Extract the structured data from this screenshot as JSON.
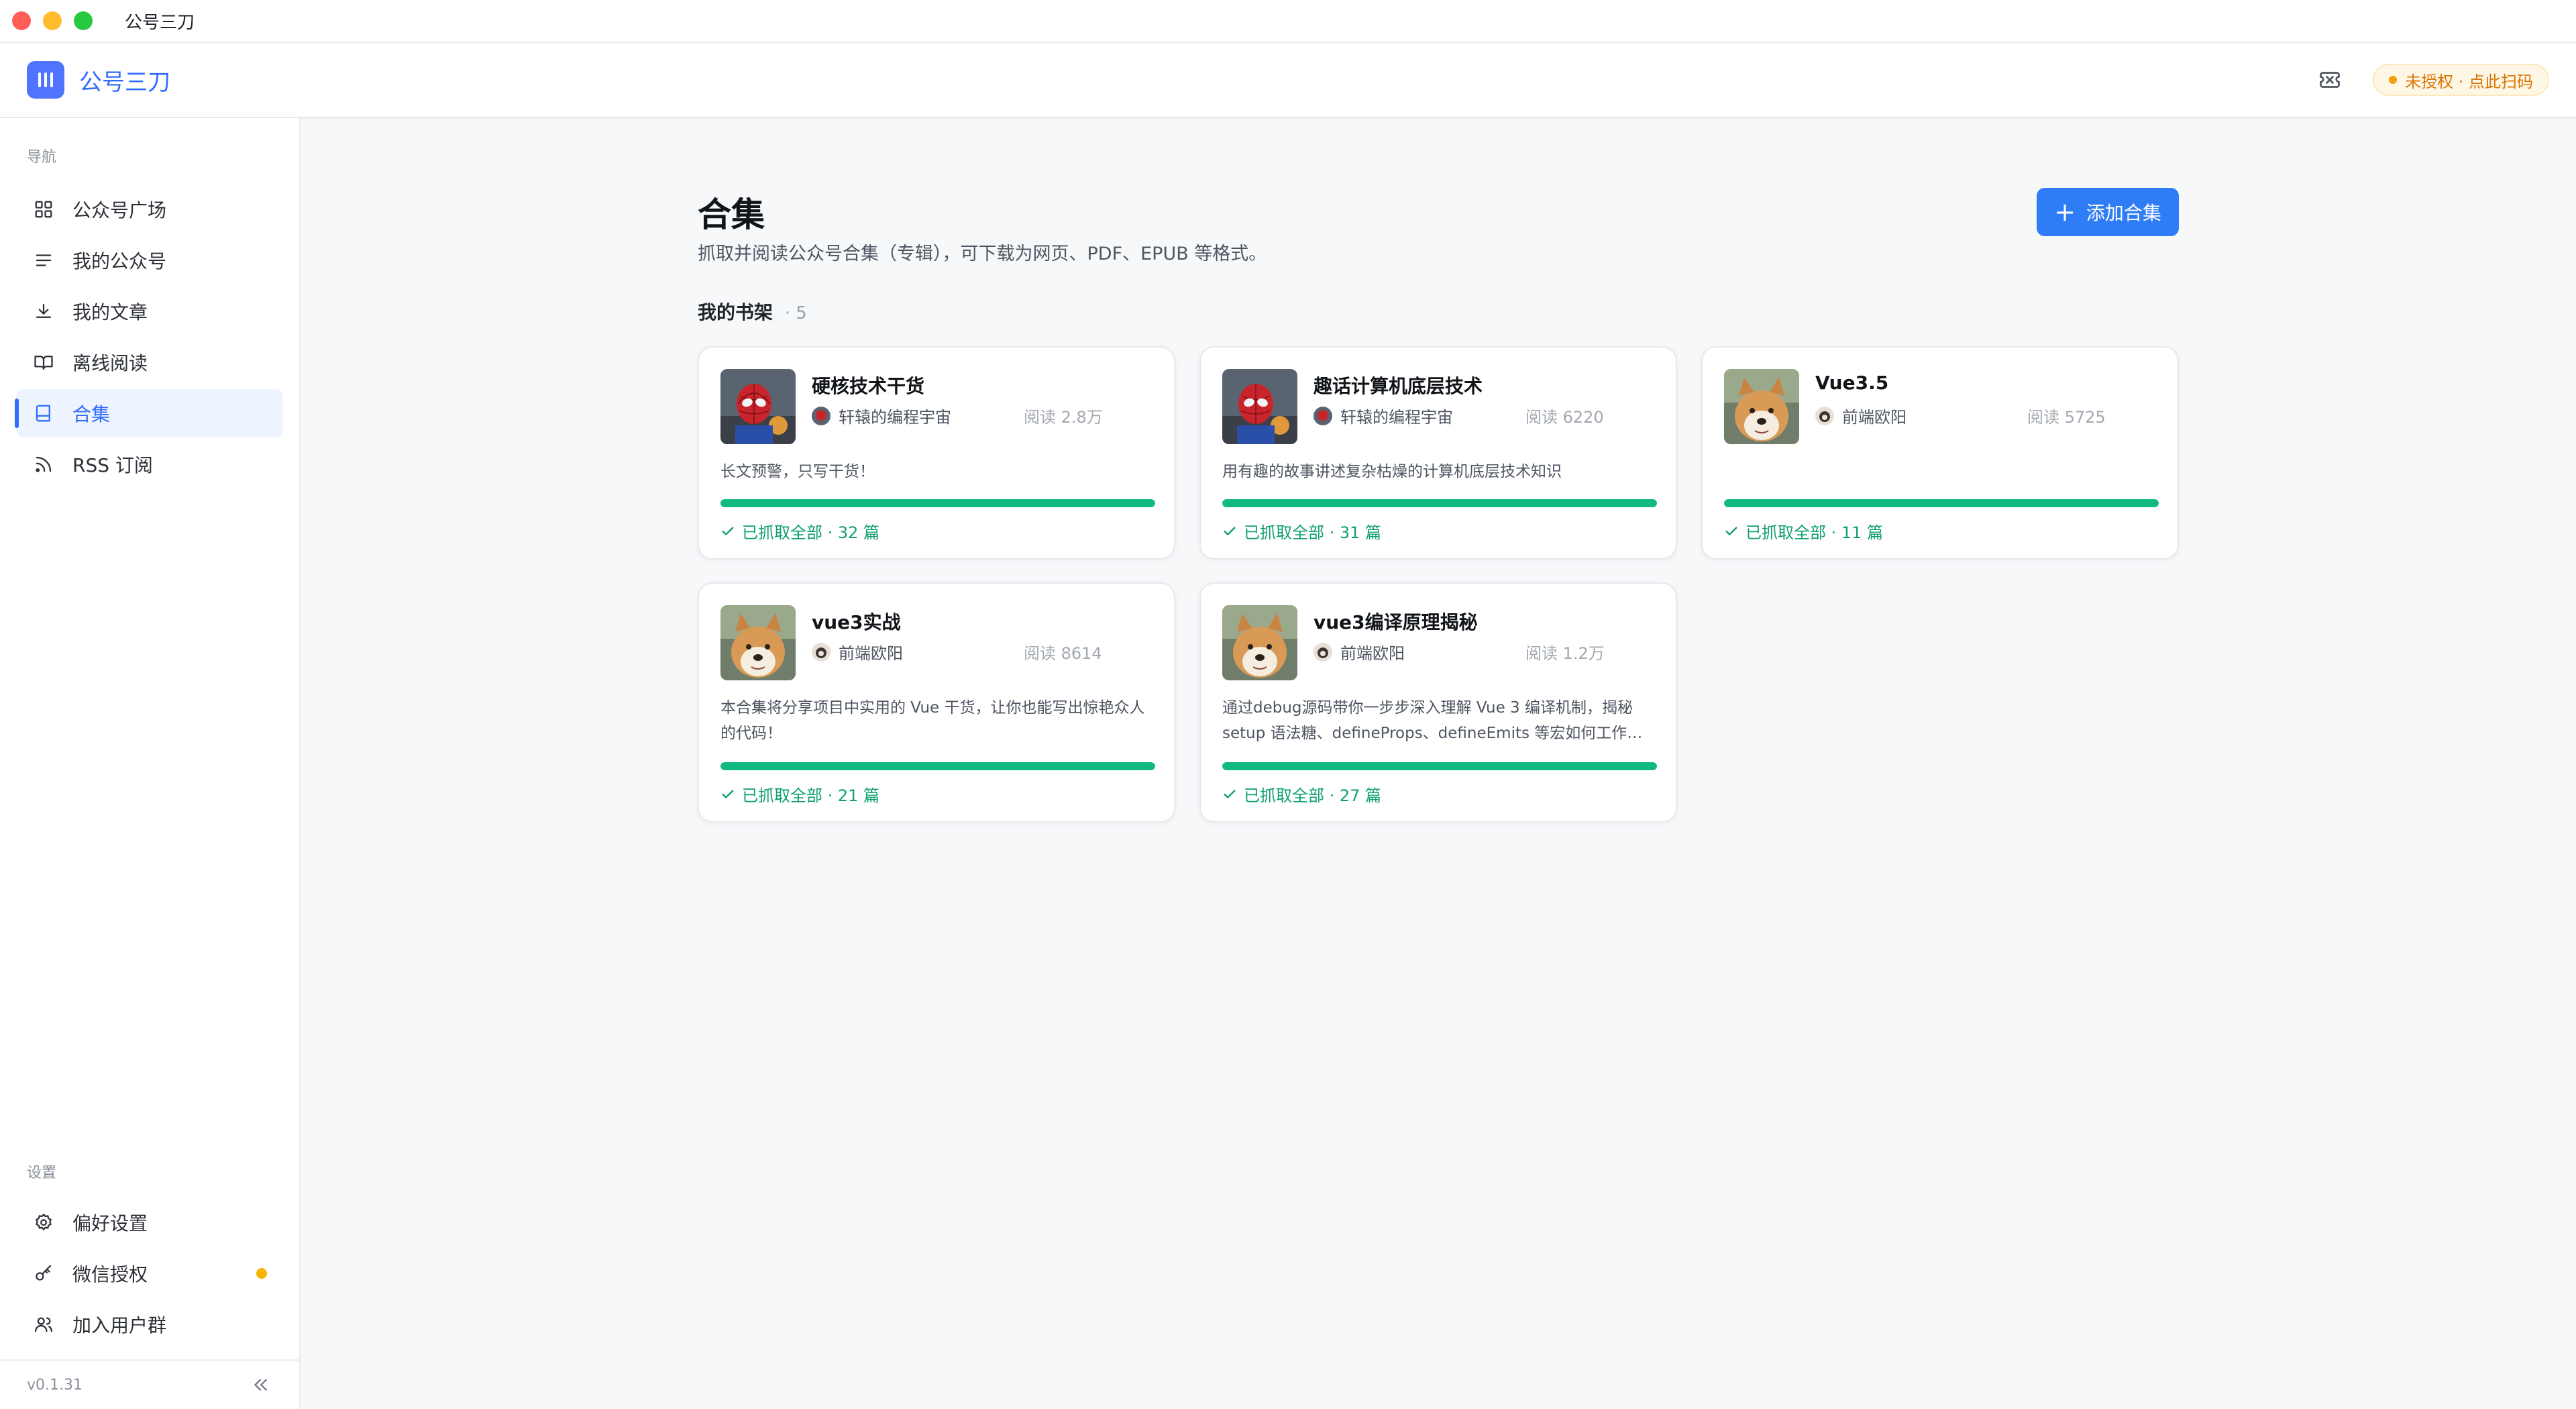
{
  "window": {
    "title": "公号三刀"
  },
  "header": {
    "brand": "公号三刀",
    "auth_badge": "未授权 · 点此扫码",
    "accent_color": "#2f6bff",
    "badge_color": "#d97706"
  },
  "sidebar": {
    "nav_label": "导航",
    "nav_items": [
      {
        "label": "公众号广场",
        "icon": "grid-icon"
      },
      {
        "label": "我的公众号",
        "icon": "list-icon"
      },
      {
        "label": "我的文章",
        "icon": "download-icon"
      },
      {
        "label": "离线阅读",
        "icon": "open-book-icon"
      },
      {
        "label": "合集",
        "icon": "book-icon",
        "active": true
      },
      {
        "label": "RSS 订阅",
        "icon": "rss-icon"
      }
    ],
    "settings_label": "设置",
    "settings_items": [
      {
        "label": "偏好设置",
        "icon": "gear-icon"
      },
      {
        "label": "微信授权",
        "icon": "key-icon",
        "warning": true
      },
      {
        "label": "加入用户群",
        "icon": "users-icon"
      }
    ],
    "version": "v0.1.31"
  },
  "main": {
    "title": "合集",
    "subtitle": "抓取并阅读公众号合集（专辑），可下载为网页、PDF、EPUB 等格式。",
    "add_button": "添加合集",
    "shelf_title": "我的书架",
    "shelf_count": "· 5",
    "progress_color": "#10b981",
    "cards": [
      {
        "title": "硬核技术干货",
        "author": "轩辕的编程宇宙",
        "reads": "阅读 2.8万",
        "description": "长文预警，只写干货！",
        "progress": 1.0,
        "status": "已抓取全部 · 32 篇",
        "cover": "spiderman"
      },
      {
        "title": "趣话计算机底层技术",
        "author": "轩辕的编程宇宙",
        "reads": "阅读 6220",
        "description": "用有趣的故事讲述复杂枯燥的计算机底层技术知识",
        "progress": 1.0,
        "status": "已抓取全部 · 31 篇",
        "cover": "spiderman"
      },
      {
        "title": "Vue3.5",
        "author": "前端欧阳",
        "reads": "阅读 5725",
        "description": "",
        "progress": 1.0,
        "status": "已抓取全部 · 11 篇",
        "cover": "shiba"
      },
      {
        "title": "vue3实战",
        "author": "前端欧阳",
        "reads": "阅读 8614",
        "description": "本合集将分享项目中实用的 Vue 干货，让你也能写出惊艳众人的代码！",
        "progress": 1.0,
        "status": "已抓取全部 · 21 篇",
        "cover": "shiba"
      },
      {
        "title": "vue3编译原理揭秘",
        "author": "前端欧阳",
        "reads": "阅读 1.2万",
        "description": "通过debug源码带你一步步深入理解 Vue 3 编译机制，揭秘 setup 语法糖、defineProps、defineEmits 等宏如何工作…",
        "progress": 1.0,
        "status": "已抓取全部 · 27 篇",
        "cover": "shiba"
      }
    ]
  }
}
